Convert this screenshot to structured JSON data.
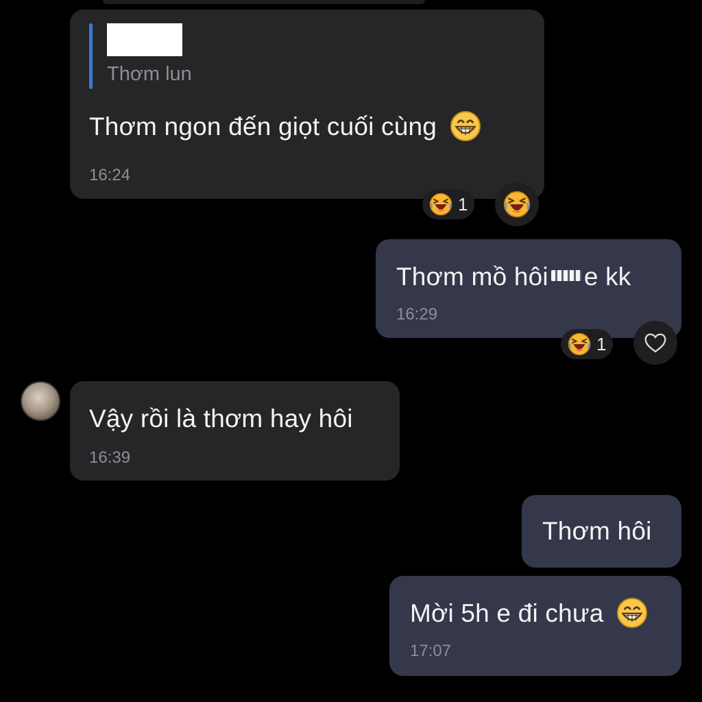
{
  "messages": [
    {
      "id": "m1",
      "side": "incoming",
      "quote": {
        "text": "Thơm lun"
      },
      "text": "Thơm ngon đến giọt cuối cùng",
      "time": "16:24",
      "reactions": {
        "count": "1"
      }
    },
    {
      "id": "m2",
      "side": "outgoing",
      "text_before": "Thơm mồ hôi",
      "text_after": "e kk",
      "time": "16:29",
      "reactions": {
        "count": "1"
      }
    },
    {
      "id": "m3",
      "side": "incoming",
      "text": "Vậy rồi là thơm hay hôi",
      "time": "16:39"
    },
    {
      "id": "m4",
      "side": "outgoing",
      "text": "Thơm hôi"
    },
    {
      "id": "m5",
      "side": "outgoing",
      "text": "Mời 5h e đi chưa",
      "time": "17:07"
    }
  ],
  "icons": {
    "grin": "grinning-face-emoji",
    "laugh": "laughing-face-emoji",
    "heart": "heart-outline-icon"
  },
  "colors": {
    "incoming_bubble": "#262628",
    "outgoing_bubble": "#34384a",
    "quote_bar": "#3a7bd5",
    "background": "#000000"
  }
}
